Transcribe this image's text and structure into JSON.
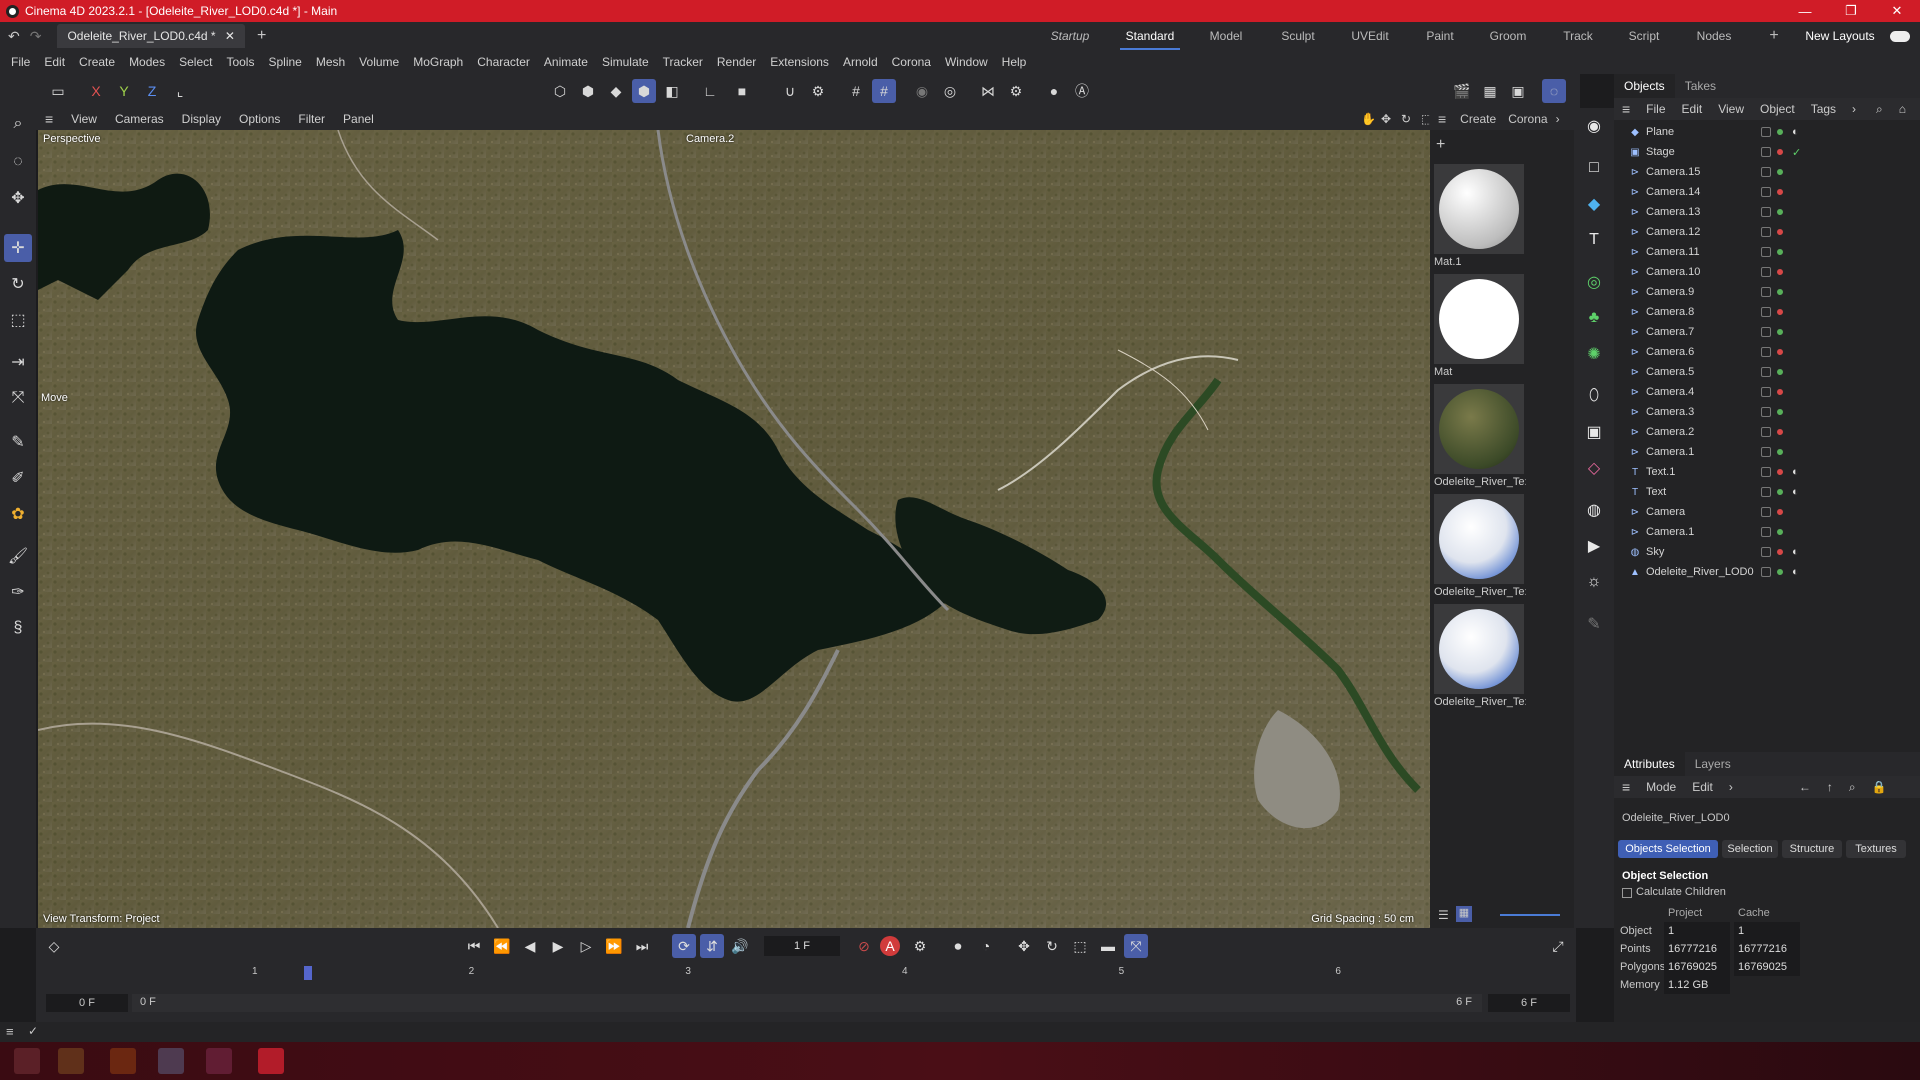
{
  "title": {
    "text": "Cinema 4D 2023.2.1 - [Odeleite_River_LOD0.c4d *] - Main"
  },
  "tabs": {
    "doc": "Odeleite_River_LOD0.c4d *"
  },
  "layouts": [
    "Startup",
    "Standard",
    "Model",
    "Sculpt",
    "UVEdit",
    "Paint",
    "Groom",
    "Track",
    "Script",
    "Nodes"
  ],
  "layout_new": "New Layouts",
  "menu": [
    "File",
    "Edit",
    "Create",
    "Modes",
    "Select",
    "Tools",
    "Spline",
    "Mesh",
    "Volume",
    "MoGraph",
    "Character",
    "Animate",
    "Simulate",
    "Tracker",
    "Render",
    "Extensions",
    "Arnold",
    "Corona",
    "Window",
    "Help"
  ],
  "axes": {
    "x": "X",
    "y": "Y",
    "z": "Z"
  },
  "viewport": {
    "menu": [
      "View",
      "Cameras",
      "Display",
      "Options",
      "Filter",
      "Panel"
    ],
    "perspective": "Perspective",
    "camera": "Camera.2",
    "move": "Move",
    "transform": "View Transform: Project",
    "grid": "Grid Spacing : 50 cm"
  },
  "materials": {
    "menu": [
      "Create",
      "Corona"
    ],
    "items": [
      {
        "name": "Mat.1",
        "color": "#e6e6e6"
      },
      {
        "name": "Mat",
        "color": "#ffffff"
      },
      {
        "name": "Odeleite_River_Te:",
        "color": "#4d5530"
      },
      {
        "name": "Odeleite_River_Te:",
        "color": "#3a68c9"
      },
      {
        "name": "Odeleite_River_Te:",
        "color": "#3a68c9"
      }
    ]
  },
  "objects": {
    "tabs": [
      "Objects",
      "Takes"
    ],
    "menu": [
      "File",
      "Edit",
      "View",
      "Object",
      "Tags"
    ],
    "items": [
      {
        "name": "Plane",
        "icon": "plane-icon",
        "tag": "material-tag"
      },
      {
        "name": "Stage",
        "icon": "stage-icon",
        "tag": "check-tag"
      },
      {
        "name": "Camera.15",
        "icon": "camera-icon"
      },
      {
        "name": "Camera.14",
        "icon": "camera-icon"
      },
      {
        "name": "Camera.13",
        "icon": "camera-icon"
      },
      {
        "name": "Camera.12",
        "icon": "camera-icon"
      },
      {
        "name": "Camera.11",
        "icon": "camera-icon"
      },
      {
        "name": "Camera.10",
        "icon": "camera-icon"
      },
      {
        "name": "Camera.9",
        "icon": "camera-icon"
      },
      {
        "name": "Camera.8",
        "icon": "camera-icon"
      },
      {
        "name": "Camera.7",
        "icon": "camera-icon"
      },
      {
        "name": "Camera.6",
        "icon": "camera-icon"
      },
      {
        "name": "Camera.5",
        "icon": "camera-icon"
      },
      {
        "name": "Camera.4",
        "icon": "camera-icon"
      },
      {
        "name": "Camera.3",
        "icon": "camera-icon"
      },
      {
        "name": "Camera.2",
        "icon": "camera-icon"
      },
      {
        "name": "Camera.1",
        "icon": "camera-icon"
      },
      {
        "name": "Text.1",
        "icon": "text-icon",
        "tag": "material-tag"
      },
      {
        "name": "Text",
        "icon": "text-icon",
        "tag": "material-tag"
      },
      {
        "name": "Camera",
        "icon": "camera-icon"
      },
      {
        "name": "Camera.1",
        "icon": "camera-icon"
      },
      {
        "name": "Sky",
        "icon": "sky-icon",
        "tag": "material-tag"
      },
      {
        "name": "Odeleite_River_LOD0",
        "icon": "polygon-object-icon",
        "tag": "material-tag"
      }
    ]
  },
  "attributes": {
    "tabs": [
      "Attributes",
      "Layers"
    ],
    "menu": [
      "Mode",
      "Edit"
    ],
    "object_name": "Odeleite_River_LOD0",
    "buttons": [
      "Objects Selection",
      "Selection",
      "Structure",
      "Textures"
    ],
    "section": "Object Selection",
    "checkbox": "Calculate Children",
    "col_project": "Project",
    "col_cache": "Cache",
    "rows": [
      {
        "label": "Object",
        "project": "1",
        "cache": "1"
      },
      {
        "label": "Points",
        "project": "16777216",
        "cache": "16777216"
      },
      {
        "label": "Polygons",
        "project": "16769025",
        "cache": "16769025"
      },
      {
        "label": "Memory",
        "project": "1.12 GB",
        "cache": ""
      }
    ]
  },
  "timeline": {
    "frame": "1 F",
    "ticks": [
      "1",
      "2",
      "3",
      "4",
      "5",
      "6"
    ],
    "start": "0 F",
    "range_start": "0 F",
    "range_end": "6 F",
    "end": "6 F"
  }
}
